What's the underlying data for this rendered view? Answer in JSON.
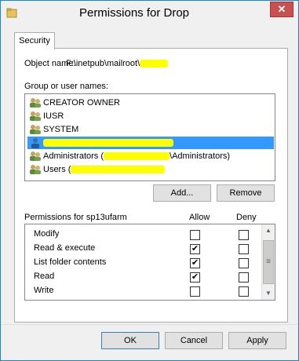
{
  "window": {
    "title": "Permissions for Drop",
    "close_label": "✕",
    "icon": "folder-icon",
    "accent_color": "#1883d7",
    "close_color": "#c75050"
  },
  "tabs": [
    {
      "label": "Security"
    }
  ],
  "object": {
    "label": "Object name:",
    "value": "F:\\inetpub\\mailroot\\"
  },
  "group_section": {
    "label": "Group or user names:",
    "items": [
      {
        "label": "CREATOR OWNER",
        "redacted": false,
        "selected": false
      },
      {
        "label": "IUSR",
        "redacted": false,
        "selected": false
      },
      {
        "label": "SYSTEM",
        "redacted": false,
        "selected": false
      },
      {
        "label": "",
        "redacted": true,
        "selected": true
      },
      {
        "label": "Administrators (",
        "suffix": "\\Administrators)",
        "redacted": true,
        "selected": false
      },
      {
        "label": "Users (",
        "redacted": true,
        "selected": false
      }
    ],
    "selected_color": "#3399ff"
  },
  "buttons": {
    "add": "Add...",
    "remove": "Remove",
    "ok": "OK",
    "cancel": "Cancel",
    "apply": "Apply"
  },
  "permissions": {
    "label": "Permissions for sp13ufarm",
    "allow_header": "Allow",
    "deny_header": "Deny",
    "rows": [
      {
        "name": "Modify",
        "allow": false,
        "deny": false
      },
      {
        "name": "Read & execute",
        "allow": true,
        "deny": false
      },
      {
        "name": "List folder contents",
        "allow": true,
        "deny": false
      },
      {
        "name": "Read",
        "allow": true,
        "deny": false
      },
      {
        "name": "Write",
        "allow": false,
        "deny": false
      }
    ]
  },
  "redaction_color": "#ffff00"
}
